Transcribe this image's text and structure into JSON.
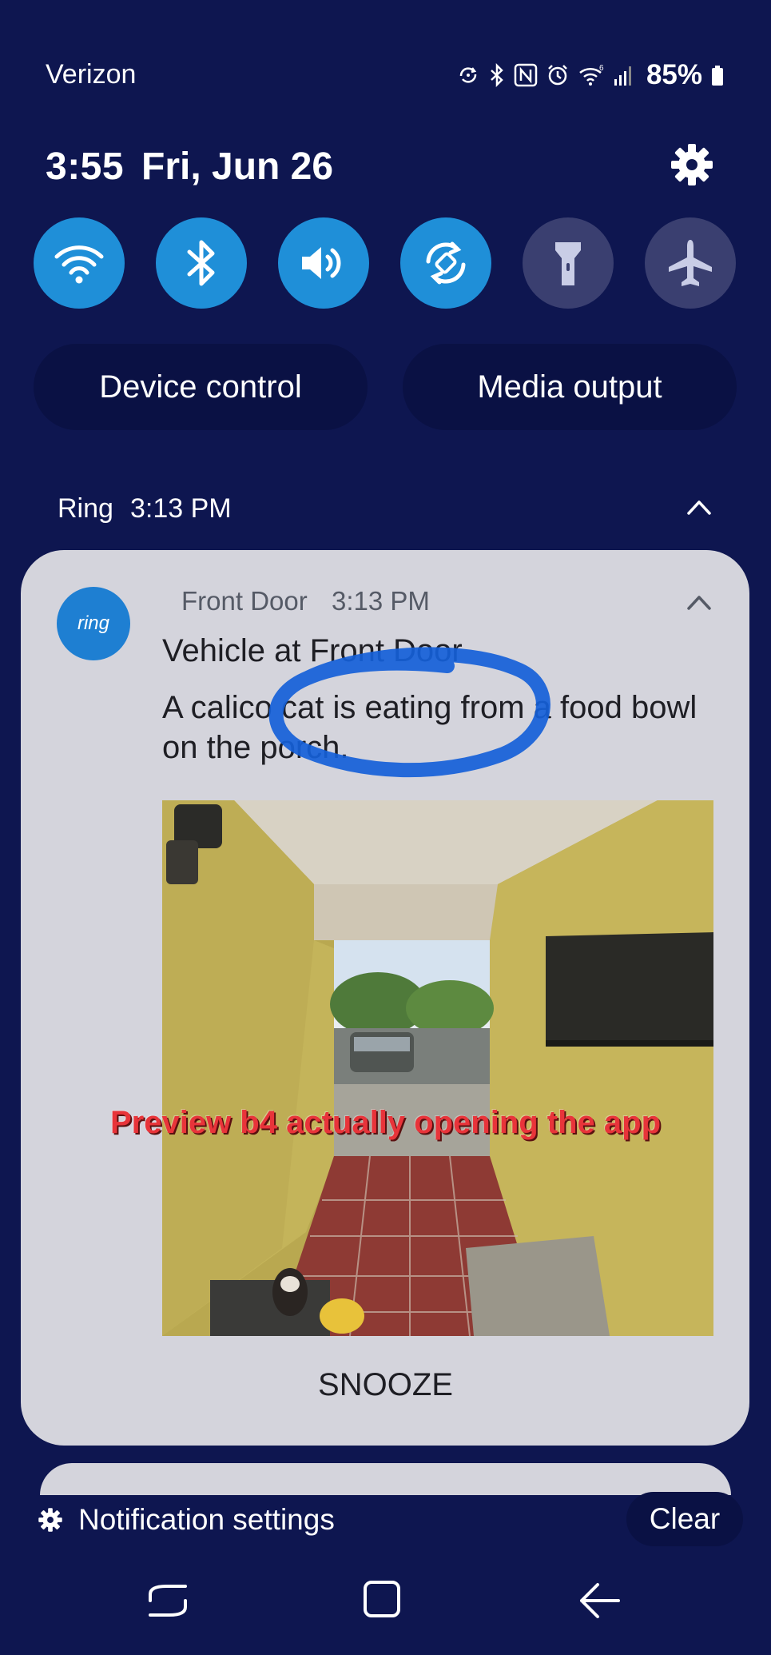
{
  "status_bar": {
    "carrier": "Verizon",
    "battery_percent": "85%",
    "icons": [
      "sync-icon",
      "bluetooth-icon",
      "nfc-icon",
      "alarm-icon",
      "wifi-icon",
      "signal-icon",
      "battery-icon"
    ]
  },
  "header": {
    "time": "3:55",
    "date": "Fri, Jun 26"
  },
  "quick_toggles": [
    {
      "name": "wifi",
      "state": "on"
    },
    {
      "name": "bluetooth",
      "state": "on"
    },
    {
      "name": "sound",
      "state": "on"
    },
    {
      "name": "auto-rotate",
      "state": "on"
    },
    {
      "name": "flashlight",
      "state": "off"
    },
    {
      "name": "airplane-mode",
      "state": "off"
    }
  ],
  "buttons": {
    "device_control": "Device control",
    "media_output": "Media output"
  },
  "notification_group": {
    "app": "Ring",
    "time": "3:13 PM"
  },
  "notification": {
    "source": "Front Door",
    "time": "3:13 PM",
    "logo_text": "ring",
    "title": "Vehicle at Front Door",
    "body": "A calico cat is eating from a food bowl on the porch.",
    "overlay_text": "Preview b4 actually opening the app",
    "action": "SNOOZE"
  },
  "footer": {
    "settings_label": "Notification settings",
    "clear_label": "Clear"
  },
  "colors": {
    "background": "#0e1650",
    "toggle_on": "#1f8fd8",
    "toggle_off": "#3a3f70",
    "card": "#d4d4dc",
    "ring_blue": "#1e7fd2",
    "scribble": "#1560d8",
    "overlay_red": "#e8343a"
  }
}
